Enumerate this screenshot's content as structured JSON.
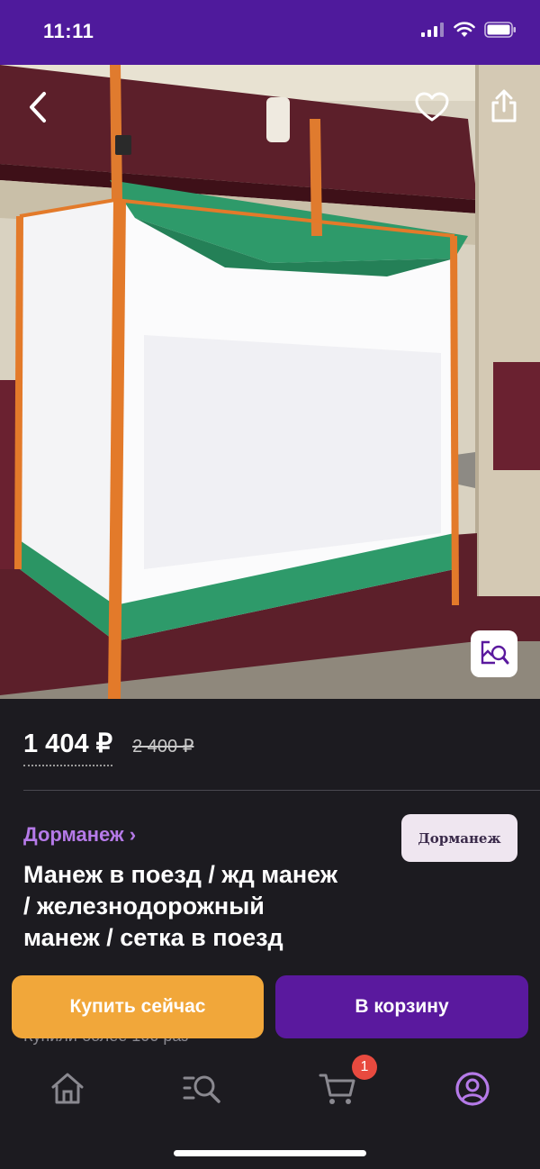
{
  "status_bar": {
    "time": "11:11"
  },
  "product": {
    "price": "1 404 ₽",
    "old_price": "2 400 ₽",
    "brand_link": "Дорманеж ›",
    "brand_logo_text": "Дорманеж",
    "title": "Манеж в поезд / жд манеж / железнодорожный манеж / сетка в поезд",
    "bought_text": "Купили более 100 раз"
  },
  "actions": {
    "buy_now": "Купить сейчас",
    "add_to_cart": "В корзину"
  },
  "tabbar": {
    "items": [
      "home-icon",
      "search-catalog-icon",
      "cart-icon",
      "profile-icon"
    ],
    "cart_badge": "1",
    "active_color": "#b57ae8",
    "inactive_color": "#8a8990"
  },
  "colors": {
    "brand_purple": "#4f1a9c",
    "buy_now": "#f1a73a",
    "cart_button": "#5a199e"
  }
}
